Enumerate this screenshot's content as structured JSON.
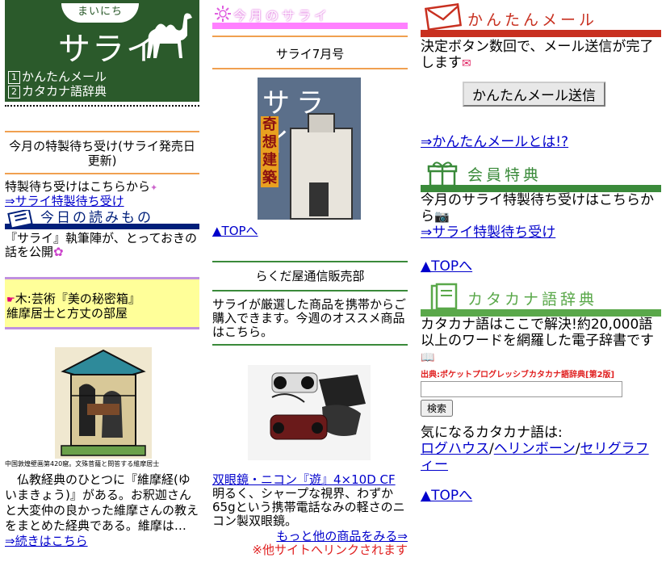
{
  "logo": {
    "tab_text": "まいにち",
    "title": "サライ",
    "menu": [
      {
        "num": "1",
        "label": "かんたんメール"
      },
      {
        "num": "2",
        "label": "カタカナ語辞典"
      }
    ]
  },
  "left": {
    "wallpaper_title": "今月の特製待ち受け(サライ発売日更新)",
    "wallpaper_text": "特製待ち受けはこちらから",
    "wallpaper_link": "⇒サライ特製待ち受け",
    "reading_heading": "今日の読みもの",
    "reading_text": "『サライ』執筆陣が、とっておきの話を公開",
    "feature_text1": "木:芸術『美の秘密箱』",
    "feature_text2": "維摩居士と方丈の部屋",
    "caption": "中国敦煌壁画第420窟。文殊菩薩と問答する維摩居士",
    "article_text": "仏教経典のひとつに『維摩経(ゆいまきょう)』がある。お釈迦さんと大変仲の良かった維摩さんの教えをまとめた経典である。維摩は…",
    "more_link": "⇒続きはこちら"
  },
  "middle": {
    "heading": "今月のサライ",
    "issue": "サライ7月号",
    "cover_title": "サライ",
    "cover_feature": "奇想建築",
    "top_link": "▲TOPへ",
    "shop_title": "らくだ屋通信販売部",
    "shop_text": "サライが厳選した商品を携帯からご購入できます。今週のオススメ商品はこちら。",
    "product_link": "双眼鏡・ニコン『遊』4×10D CF",
    "product_text": "明るく、シャープな視界、わずか65gという携帯電話なみの軽さのニコン製双眼鏡。",
    "more_products": "もっと他の商品をみる⇒",
    "external_note": "※他サイトへリンクされます"
  },
  "right": {
    "mail_heading": "かんたんメール",
    "mail_text": "決定ボタン数回で、メール送信が完了します",
    "mail_button": "かんたんメール送信",
    "mail_about": "⇒かんたんメールとは!?",
    "member_heading": "会員特典",
    "member_text": "今月のサライ特製待ち受けはこちらから",
    "member_link": "⇒サライ特製待ち受け",
    "top_link": "▲TOPへ",
    "dict_heading": "カタカナ語辞典",
    "dict_text": "カタカナ語はここで解決!約20,000語以上のワードを網羅した電子辞書です",
    "source": "出典:ポケットプログレッシブカタカナ語辞典[第2版]",
    "search_value": "",
    "search_button": "検索",
    "words_intro": "気になるカタカナ語は:",
    "words": [
      "ログハウス",
      "ヘリンボーン",
      "セリグラフィー"
    ],
    "top_link2": "▲TOPへ"
  },
  "colors": {
    "logo_green": "#2b5a2b",
    "link": "#0000cc",
    "pink": "#ff80ff",
    "navy": "#001f7a",
    "red": "#c83020",
    "leaf_green": "#3a8a3a"
  }
}
